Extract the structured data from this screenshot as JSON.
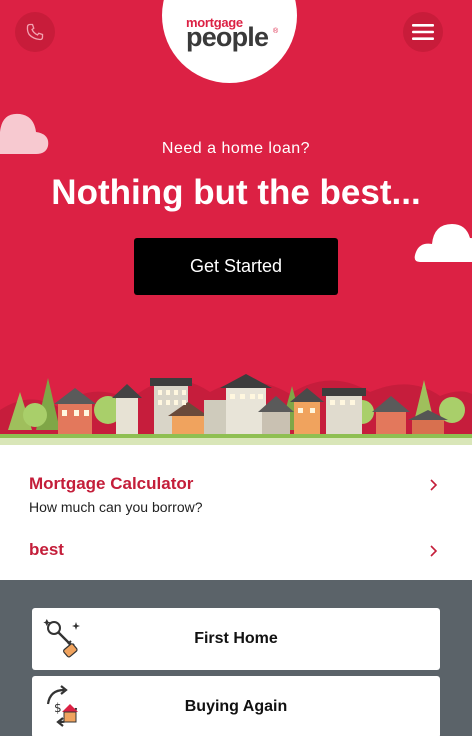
{
  "header": {
    "logo_small": "mortgage",
    "logo_big": "people",
    "logo_reg": "®",
    "phone_icon": "phone-icon",
    "menu_icon": "hamburger-menu-icon"
  },
  "hero": {
    "tagline": "Need a home loan?",
    "headline": "Nothing but the best...",
    "cta_label": "Get Started",
    "background_color": "#dc2144"
  },
  "links": [
    {
      "title": "Mortgage Calculator",
      "subtitle": "How much can you borrow?"
    },
    {
      "title": "best"
    }
  ],
  "cards": [
    {
      "label": "First Home",
      "icon": "keys-icon"
    },
    {
      "label": "Buying Again",
      "icon": "house-arrows-icon"
    }
  ],
  "colors": {
    "brand_red": "#dc2144",
    "link_red": "#c41e3a",
    "cards_bg": "#5b6369"
  }
}
